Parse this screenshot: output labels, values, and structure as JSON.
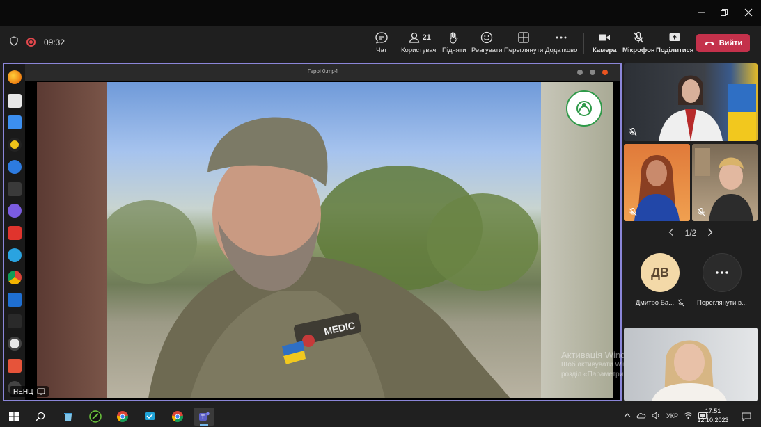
{
  "window": {
    "minimize_icon": "minimize-icon",
    "restore_icon": "restore-icon",
    "close_icon": "close-icon"
  },
  "meeting": {
    "timer": "09:32",
    "participants_count": "21",
    "buttons": {
      "chat": "Чат",
      "people": "Користувачі",
      "raise": "Підняти",
      "react": "Реагувати",
      "view": "Переглянути",
      "more": "Додатково",
      "camera": "Камера",
      "mic": "Мікрофон",
      "share": "Поділитися",
      "leave": "Вийти"
    },
    "colors": {
      "leave": "#c4314b",
      "stage_border": "#8b86d9",
      "recording": "#e5484d"
    }
  },
  "stage": {
    "window_title": "Героі 0.mp4",
    "badge_text": "MEDIC",
    "presenter_caption": "НЕНЦ"
  },
  "watermark": {
    "line1": "Активація Windows",
    "line2": "Щоб активувати Windows, перейдіть в",
    "line3": "розділ «Параметри»."
  },
  "sidebar": {
    "pager": "1/2",
    "avatars": [
      {
        "initials": "ДВ",
        "name": "Дмитро Ба...",
        "color": "#f3d9a8",
        "text_color": "#5a4630"
      },
      {
        "initials": "···",
        "name": "Переглянути в...",
        "color": "#2b2b2b",
        "text_color": "#ffffff"
      }
    ]
  },
  "taskbar": {
    "language": "УКР",
    "time": "17:51",
    "date": "12.10.2023"
  }
}
